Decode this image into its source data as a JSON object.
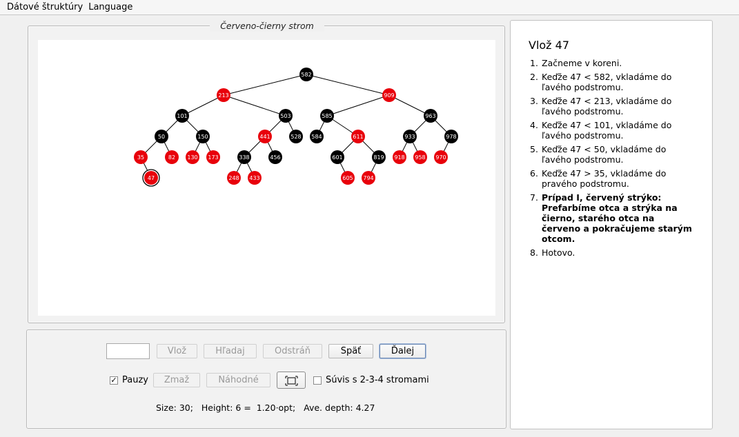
{
  "menu": {
    "items": [
      {
        "label": "Dátové štruktúry",
        "mnemonic": "D"
      },
      {
        "label": "Language",
        "mnemonic": "L"
      }
    ]
  },
  "tree_panel": {
    "title": "Červeno-čierny strom"
  },
  "tree": {
    "nodes": [
      {
        "id": "582",
        "color": "black"
      },
      {
        "id": "213",
        "color": "red",
        "parent": "582"
      },
      {
        "id": "909",
        "color": "red",
        "parent": "582"
      },
      {
        "id": "101",
        "color": "black",
        "parent": "213"
      },
      {
        "id": "503",
        "color": "black",
        "parent": "213"
      },
      {
        "id": "585",
        "color": "black",
        "parent": "909"
      },
      {
        "id": "963",
        "color": "black",
        "parent": "909"
      },
      {
        "id": "50",
        "color": "black",
        "parent": "101"
      },
      {
        "id": "150",
        "color": "black",
        "parent": "101"
      },
      {
        "id": "441",
        "color": "red",
        "parent": "503"
      },
      {
        "id": "528",
        "color": "black",
        "parent": "503"
      },
      {
        "id": "584",
        "color": "black",
        "parent": "585"
      },
      {
        "id": "611",
        "color": "red",
        "parent": "585"
      },
      {
        "id": "933",
        "color": "black",
        "parent": "963"
      },
      {
        "id": "978",
        "color": "black",
        "parent": "963"
      },
      {
        "id": "35",
        "color": "red",
        "parent": "50"
      },
      {
        "id": "82",
        "color": "red",
        "parent": "50"
      },
      {
        "id": "130",
        "color": "red",
        "parent": "150"
      },
      {
        "id": "173",
        "color": "red",
        "parent": "150"
      },
      {
        "id": "338",
        "color": "black",
        "parent": "441"
      },
      {
        "id": "456",
        "color": "black",
        "parent": "441"
      },
      {
        "id": "601",
        "color": "black",
        "parent": "611"
      },
      {
        "id": "819",
        "color": "black",
        "parent": "611"
      },
      {
        "id": "918",
        "color": "red",
        "parent": "933"
      },
      {
        "id": "958",
        "color": "red",
        "parent": "933"
      },
      {
        "id": "970",
        "color": "red",
        "parent": "978"
      },
      {
        "id": "47",
        "color": "red",
        "parent": "35",
        "highlighted": true
      },
      {
        "id": "248",
        "color": "red",
        "parent": "338"
      },
      {
        "id": "433",
        "color": "red",
        "parent": "338"
      },
      {
        "id": "605",
        "color": "red",
        "parent": "601"
      },
      {
        "id": "794",
        "color": "red",
        "parent": "819"
      }
    ]
  },
  "controls": {
    "input_value": "",
    "insert_label": "Vlož",
    "search_label": "Hľadaj",
    "delete_label": "Odstráň",
    "back_label": "Späť",
    "next_label": "Ďalej",
    "pause_label": "Pauzy",
    "pause_checked": true,
    "clear_label": "Zmaž",
    "random_label": "Náhodné",
    "link234_label": "Súvis s 2-3-4 stromami",
    "link234_checked": false
  },
  "stats": {
    "text": "Size: 30;   Height: 6 =  1.20·opt;   Ave. depth: 4.27"
  },
  "info": {
    "title": "Vlož 47",
    "steps": [
      {
        "num": "1.",
        "text": "Začneme v koreni.",
        "bold": false
      },
      {
        "num": "2.",
        "text": "Keďže 47 < 582, vkladáme do ľavého podstromu.",
        "bold": false
      },
      {
        "num": "3.",
        "text": "Keďže 47 < 213, vkladáme do ľavého podstromu.",
        "bold": false
      },
      {
        "num": "4.",
        "text": "Keďže 47 < 101, vkladáme do ľavého podstromu.",
        "bold": false
      },
      {
        "num": "5.",
        "text": "Keďže 47 < 50, vkladáme do ľavého podstromu.",
        "bold": false
      },
      {
        "num": "6.",
        "text": "Keďže 47 > 35, vkladáme do pravého podstromu.",
        "bold": false
      },
      {
        "num": "7.",
        "text": "Prípad I, červený strýko: Prefarbíme otca a strýka na čierno, starého otca na červeno a pokračujeme starým otcom.",
        "bold": true
      },
      {
        "num": "8.",
        "text": "Hotovo.",
        "bold": false
      }
    ]
  },
  "colors": {
    "red_node": "#e8000b",
    "black_node": "#000000"
  }
}
